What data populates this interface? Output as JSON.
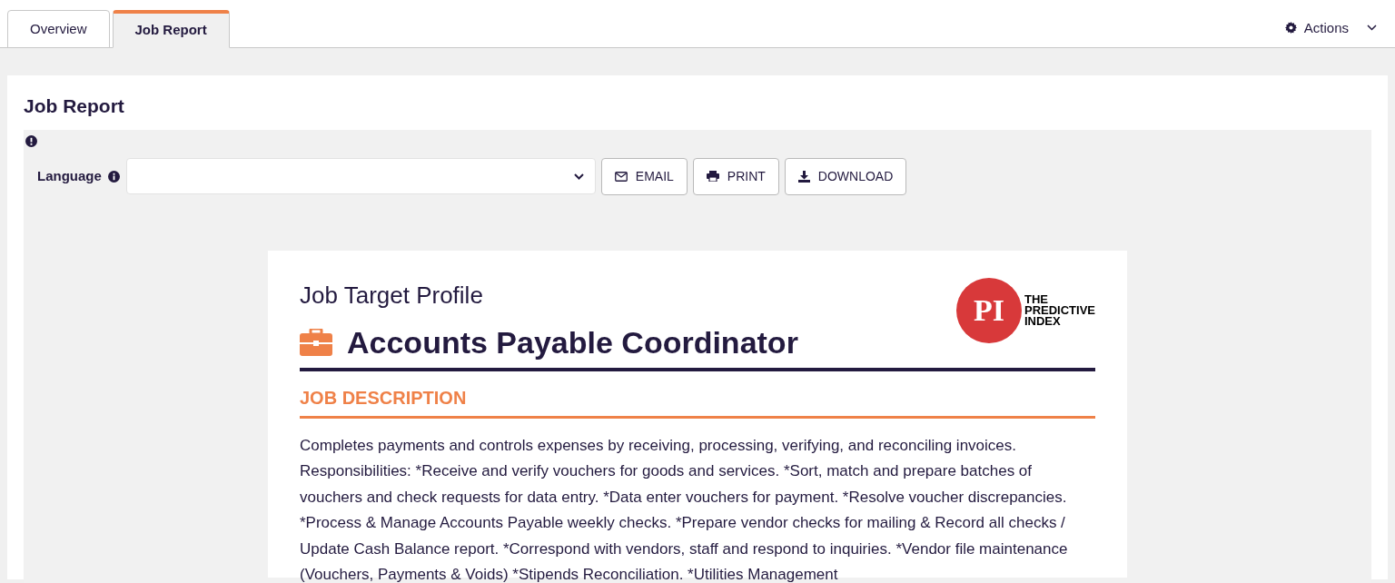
{
  "tabs": [
    {
      "label": "Overview",
      "selected": false
    },
    {
      "label": "Job Report",
      "selected": true
    }
  ],
  "actions_menu": {
    "label": "Actions"
  },
  "panel": {
    "title": "Job Report",
    "language": {
      "label": "Language"
    },
    "buttons": [
      {
        "kind": "email",
        "label": "EMAIL"
      },
      {
        "kind": "print",
        "label": "PRINT"
      },
      {
        "kind": "download",
        "label": "DOWNLOAD"
      }
    ]
  },
  "report": {
    "subtitle": "Job Target Profile",
    "job_title": "Accounts Payable Coordinator",
    "logo": {
      "mark": "PI",
      "lines": [
        "THE",
        "PREDICTIVE",
        "INDEX"
      ]
    },
    "section_heading": "JOB DESCRIPTION",
    "description": "Completes payments and controls expenses by receiving, processing, verifying, and reconciling invoices. Responsibilities: *Receive and verify vouchers for goods and services. *Sort, match and prepare batches of vouchers and check requests for data entry. *Data enter vouchers for payment. *Resolve voucher discrepancies. *Process & Manage Accounts Payable weekly checks. *Prepare vendor checks for mailing & Record all checks / Update Cash Balance report. *Correspond with vendors, staff and respond to inquiries. *Vendor file maintenance (Vouchers, Payments & Voids) *Stipends Reconciliation. *Utilities Management"
  }
}
